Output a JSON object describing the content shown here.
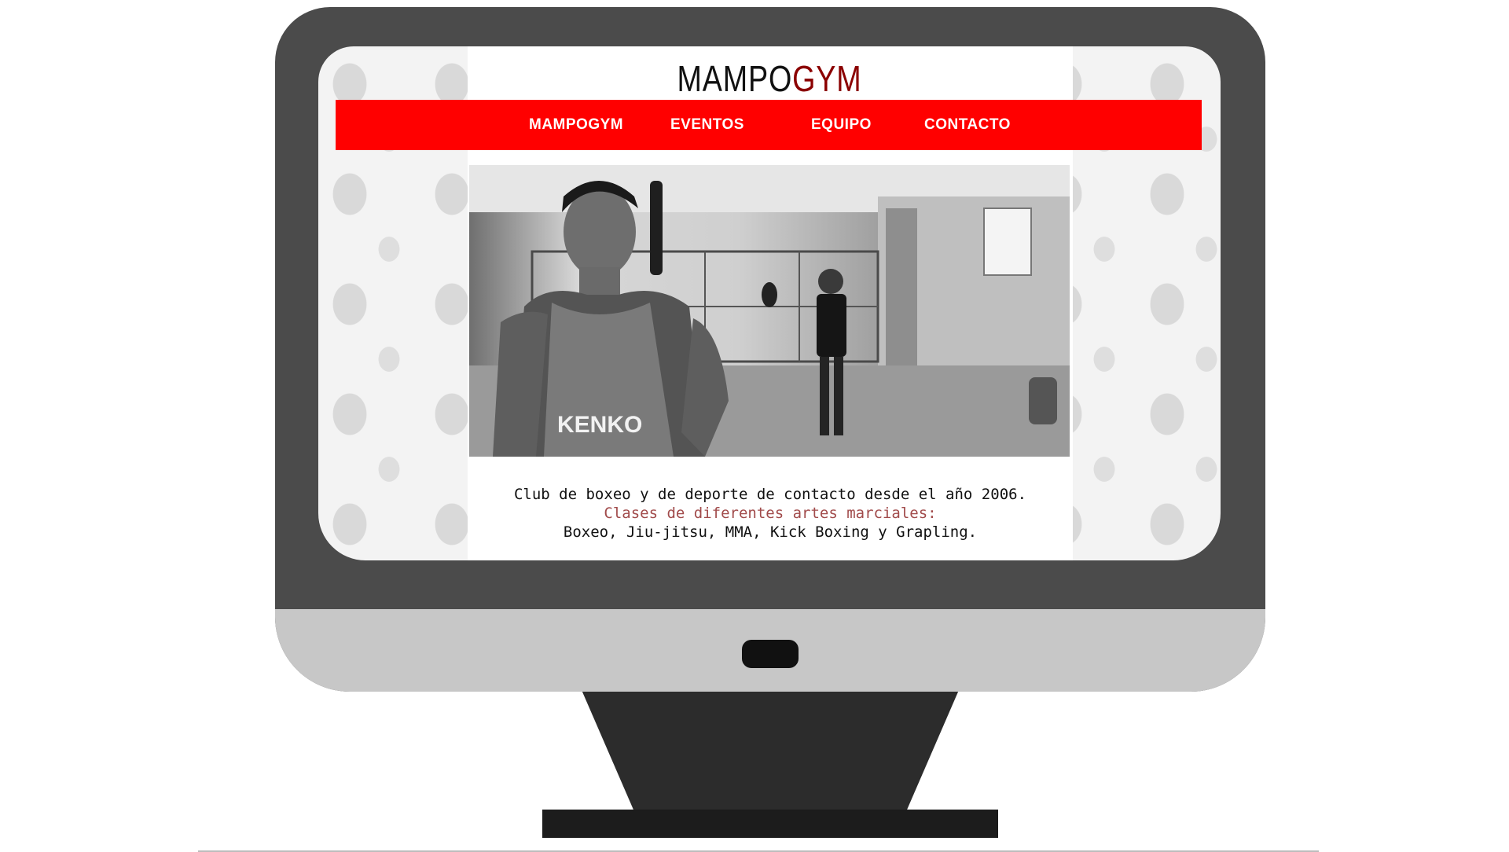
{
  "logo": {
    "part1": "MAMPO",
    "part2": "GYM"
  },
  "nav": {
    "items": [
      {
        "label": "MAMPOGYM"
      },
      {
        "label": "EVENTOS"
      },
      {
        "label": "EQUIPO"
      },
      {
        "label": "CONTACTO"
      }
    ]
  },
  "hero": {
    "shirt_text": "KENKO"
  },
  "caption": {
    "line1": "Club de boxeo y de deporte de contacto desde el año 2006.",
    "line2": "Clases de diferentes artes marciales:",
    "line3": "Boxeo, Jiu-jitsu, MMA, Kick Boxing y Grapling."
  },
  "colors": {
    "nav_bg": "#ff0000",
    "accent": "#8b0000",
    "subtitle": "#a14b4b"
  }
}
